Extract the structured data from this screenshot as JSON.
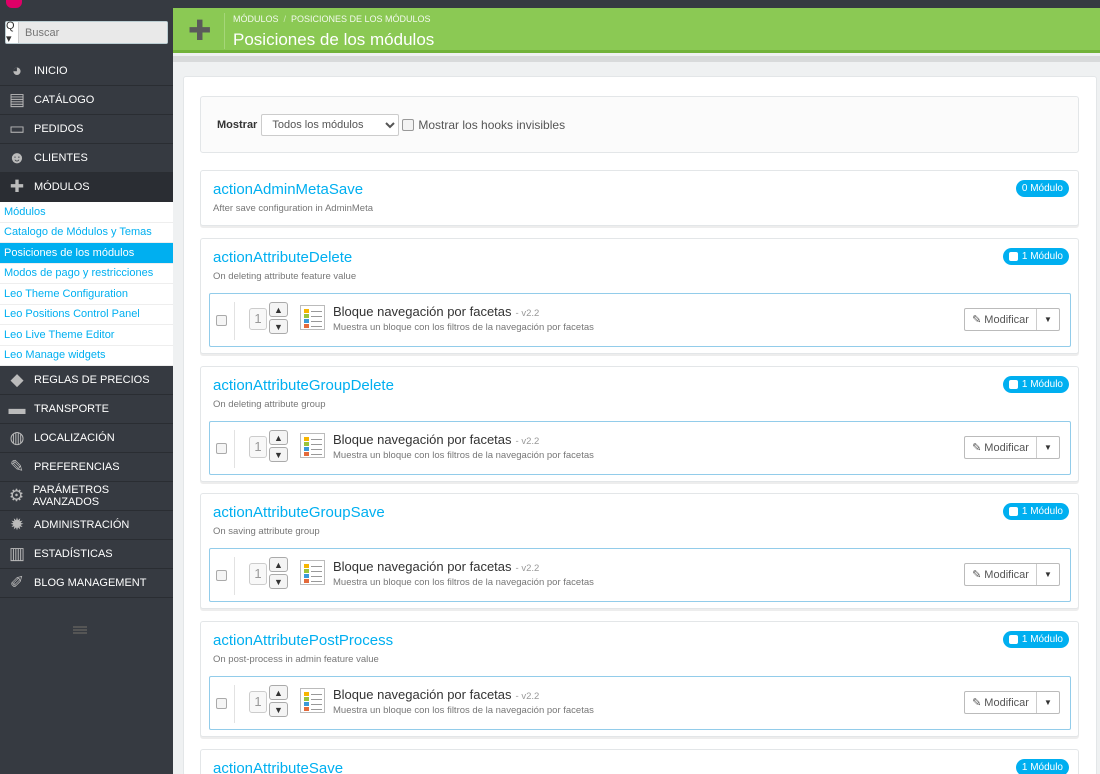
{
  "search": {
    "placeholder": "Buscar",
    "button": "Q ▾"
  },
  "sidebar": {
    "items_top": [
      {
        "label": "INICIO",
        "icon": "dashboard-icon",
        "glyph": "◕"
      },
      {
        "label": "CATÁLOGO",
        "icon": "catalog-icon",
        "glyph": "▤"
      },
      {
        "label": "PEDIDOS",
        "icon": "orders-icon",
        "glyph": "▭"
      },
      {
        "label": "CLIENTES",
        "icon": "customers-icon",
        "glyph": "☻"
      },
      {
        "label": "MÓDULOS",
        "icon": "puzzle-icon",
        "glyph": "✚"
      }
    ],
    "submenu": [
      "Módulos",
      "Catalogo de Módulos y Temas",
      "Posiciones de los módulos",
      "Modos de pago y restricciones",
      "Leo Theme Configuration",
      "Leo Positions Control Panel",
      "Leo Live Theme Editor",
      "Leo Manage widgets"
    ],
    "active_submenu": 2,
    "items_bottom": [
      {
        "label": "REGLAS DE PRECIOS",
        "icon": "tag-icon",
        "glyph": "◆"
      },
      {
        "label": "TRANSPORTE",
        "icon": "truck-icon",
        "glyph": "▬"
      },
      {
        "label": "LOCALIZACIÓN",
        "icon": "globe-icon",
        "glyph": "◍"
      },
      {
        "label": "PREFERENCIAS",
        "icon": "wrench-icon",
        "glyph": "✎"
      },
      {
        "label": "PARÁMETROS AVANZADOS",
        "icon": "cogs-icon",
        "glyph": "⚙"
      },
      {
        "label": "ADMINISTRACIÓN",
        "icon": "gear-icon",
        "glyph": "✹"
      },
      {
        "label": "ESTADÍSTICAS",
        "icon": "stats-icon",
        "glyph": "▥"
      },
      {
        "label": "BLOG MANAGEMENT",
        "icon": "pencil-icon",
        "glyph": "✐"
      }
    ]
  },
  "header": {
    "breadcrumb": [
      "MÓDULOS",
      "POSICIONES DE LOS MÓDULOS"
    ],
    "title": "Posiciones de los módulos"
  },
  "filter": {
    "label": "Mostrar",
    "select_value": "Todos los módulos",
    "checkbox_label": "Mostrar los hooks invisibles"
  },
  "hooks": [
    {
      "name": "actionAdminMetaSave",
      "desc": "After save configuration in AdminMeta",
      "badge": "0 Módulo",
      "module": null
    },
    {
      "name": "actionAttributeDelete",
      "desc": "On deleting attribute feature value",
      "badge": "1 Módulo",
      "module": {
        "position": "1",
        "name": "Bloque navegación por facetas",
        "version": "- v2.2",
        "desc": "Muestra un bloque con los filtros de la navegación por facetas",
        "edit": "Modificar"
      }
    },
    {
      "name": "actionAttributeGroupDelete",
      "desc": "On deleting attribute group",
      "badge": "1 Módulo",
      "module": {
        "position": "1",
        "name": "Bloque navegación por facetas",
        "version": "- v2.2",
        "desc": "Muestra un bloque con los filtros de la navegación por facetas",
        "edit": "Modificar"
      }
    },
    {
      "name": "actionAttributeGroupSave",
      "desc": "On saving attribute group",
      "badge": "1 Módulo",
      "module": {
        "position": "1",
        "name": "Bloque navegación por facetas",
        "version": "- v2.2",
        "desc": "Muestra un bloque con los filtros de la navegación por facetas",
        "edit": "Modificar"
      }
    },
    {
      "name": "actionAttributePostProcess",
      "desc": "On post-process in admin feature value",
      "badge": "1 Módulo",
      "module": {
        "position": "1",
        "name": "Bloque navegación por facetas",
        "version": "- v2.2",
        "desc": "Muestra un bloque con los filtros de la navegación por facetas",
        "edit": "Modificar"
      }
    },
    {
      "name": "actionAttributeSave",
      "desc": "",
      "badge": "1 Módulo",
      "module": null
    }
  ]
}
